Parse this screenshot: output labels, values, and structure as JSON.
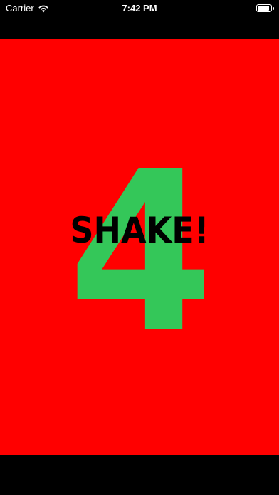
{
  "status_bar": {
    "carrier": "Carrier",
    "wifi_icon": "wifi-icon",
    "time": "7:42 PM",
    "battery_icon": "battery-icon"
  },
  "game": {
    "background_color": "#ff0000",
    "countdown_number": "4",
    "countdown_color": "#34c759",
    "prompt": "SHAKE!",
    "prompt_color": "#000000"
  }
}
